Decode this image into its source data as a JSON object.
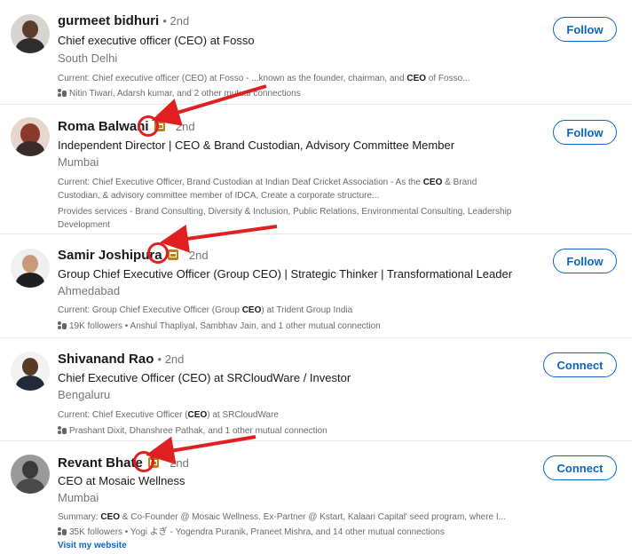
{
  "results": [
    {
      "name": "gurmeet bidhuri",
      "degree": "• 2nd",
      "headline": "Chief executive officer (CEO) at Fosso",
      "location": "South Delhi",
      "current_pre": "Current: Chief executive officer (CEO) at Fosso - ...known as the founder, chairman, and ",
      "current_bold": "CEO",
      "current_post": " of Fosso...",
      "mutual": "Nitin Tiwari, Adarsh kumar, and 2 other mutual connections",
      "button": "Follow"
    },
    {
      "name": "Roma Balwani",
      "degree": "2nd",
      "headline": "Independent Director | CEO & Brand Custodian, Advisory Committee Member",
      "location": "Mumbai",
      "current_pre": "Current: Chief Executive Officer, Brand Custodian at Indian Deaf Cricket Association - As the ",
      "current_bold": "CEO",
      "current_post": " & Brand Custodian, & advisory committee member of IDCA, Create a corporate structure...",
      "services": "Provides services - Brand Consulting, Diversity & Inclusion, Public Relations, Environmental Consulting, Leadership Development",
      "button": "Follow"
    },
    {
      "name": "Samir Joshipura",
      "degree": "2nd",
      "headline": "Group Chief Executive Officer (Group CEO) | Strategic Thinker | Transformational Leader",
      "location": "Ahmedabad",
      "current_pre": "Current: Group Chief Executive Officer (Group ",
      "current_bold": "CEO",
      "current_post": ") at Trident Group India",
      "mutual": "19K followers • Anshul Thapliyal, Sambhav Jain, and 1 other mutual connection",
      "button": "Follow"
    },
    {
      "name": "Shivanand Rao",
      "degree": "• 2nd",
      "headline": "Chief Executive Officer (CEO) at SRCloudWare / Investor",
      "location": "Bengaluru",
      "current_pre": "Current: Chief Executive Officer (",
      "current_bold": "CEO",
      "current_post": ") at SRCloudWare",
      "mutual": "Prashant Dixit, Dhanshree Pathak, and 1 other mutual connection",
      "button": "Connect"
    },
    {
      "name": "Revant Bhate",
      "degree": "2nd",
      "headline": "CEO at Mosaic Wellness",
      "location": "Mumbai",
      "current_pre": "Summary: ",
      "current_bold": "CEO",
      "current_post": " & Co-Founder @ Mosaic Wellness. Ex-Partner @ Kstart, Kalaari Capital' seed program, where I...",
      "mutual": "35K followers • Yogi よぎ - Yogendra Puranik, Praneet Mishra, and 14 other mutual connections",
      "link": "Visit my website",
      "button": "Connect"
    }
  ],
  "colors": {
    "accent": "#0a66c2",
    "annotation": "#e02020",
    "badge": "#c37d16"
  }
}
